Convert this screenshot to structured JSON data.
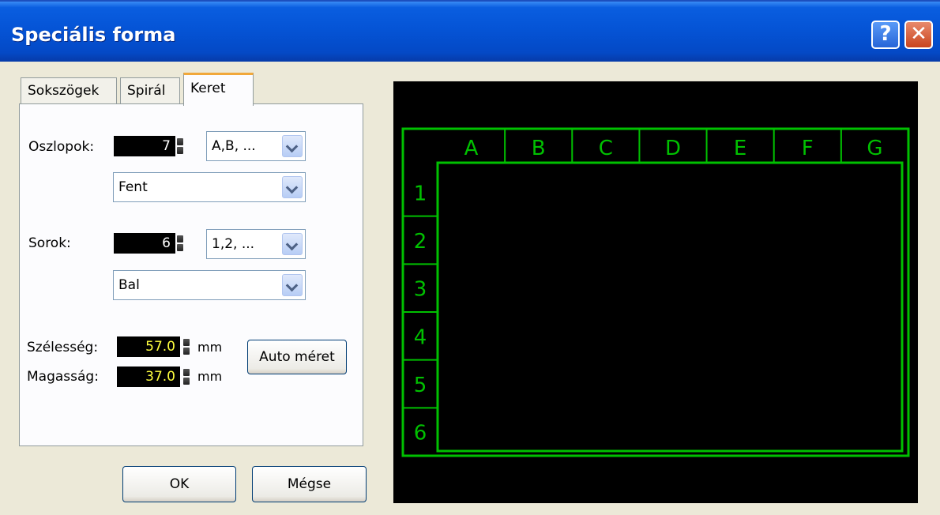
{
  "window": {
    "title": "Speciális forma",
    "help_label": "?",
    "close_label": "✕"
  },
  "tabs": [
    {
      "label": "Sokszögek",
      "active": false
    },
    {
      "label": "Spirál",
      "active": false
    },
    {
      "label": "Keret",
      "active": true
    }
  ],
  "columns": {
    "label": "Oszlopok:",
    "value": "7",
    "format": "A,B, ...",
    "position": "Fent"
  },
  "rows": {
    "label": "Sorok:",
    "value": "6",
    "format": "1,2, ...",
    "position": "Bal"
  },
  "size": {
    "width_label": "Szélesség:",
    "width_value": "57.0",
    "width_unit": "mm",
    "height_label": "Magasság:",
    "height_value": "37.0",
    "height_unit": "mm"
  },
  "auto_size_button": "Auto méret",
  "ok_button": "OK",
  "cancel_button": "Mégse",
  "preview": {
    "column_headers": [
      "A",
      "B",
      "C",
      "D",
      "E",
      "F",
      "G"
    ],
    "row_headers": [
      "1",
      "2",
      "3",
      "4",
      "5",
      "6"
    ],
    "line_color": "#00c000",
    "background": "#000000"
  }
}
